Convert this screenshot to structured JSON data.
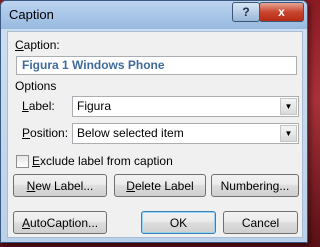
{
  "window": {
    "title": "Caption"
  },
  "titlebar": {
    "help": "?",
    "close": "x"
  },
  "caption": {
    "label_prefix": "",
    "label_mnemonic": "C",
    "label_rest": "aption:",
    "value": "Figura 1 Windows Phone"
  },
  "options": {
    "heading": "Options",
    "label_field": {
      "mnemonic": "L",
      "rest": "abel:",
      "value": "Figura"
    },
    "position_field": {
      "mnemonic": "P",
      "rest": "osition:",
      "value": "Below selected item"
    },
    "exclude": {
      "mnemonic": "E",
      "rest": "xclude label from caption",
      "checked": false
    }
  },
  "buttons": {
    "new_label": {
      "mnemonic": "N",
      "rest": "ew Label..."
    },
    "delete_label": {
      "mnemonic": "D",
      "rest": "elete Label"
    },
    "numbering": {
      "prefix": "Numbering...",
      "mnemonic": "U"
    },
    "autocaption": {
      "mnemonic": "A",
      "rest": "utoCaption..."
    },
    "ok": "OK",
    "cancel": "Cancel"
  },
  "icons": {
    "dropdown": "chevron-down-icon",
    "close": "close-icon",
    "help": "help-icon"
  }
}
